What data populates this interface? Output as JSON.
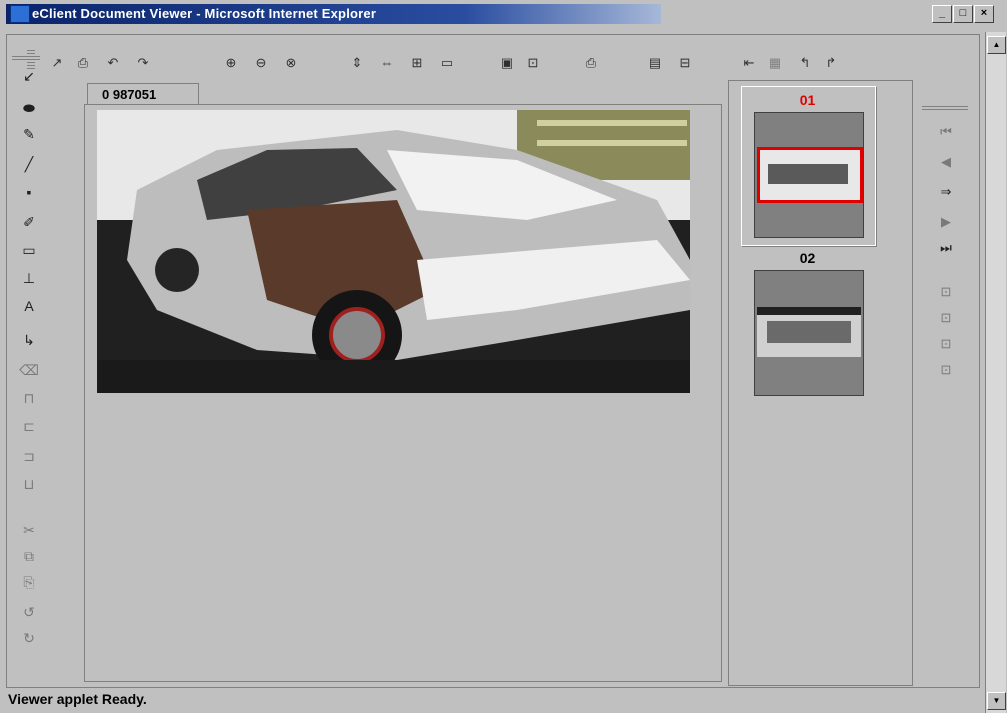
{
  "window": {
    "title": "eClient Document Viewer - Microsoft Internet Explorer"
  },
  "document_tab": {
    "label": "0 987051"
  },
  "thumbnails": [
    {
      "number": "01",
      "selected": true,
      "number_color": "#e00000"
    },
    {
      "number": "02",
      "selected": false,
      "number_color": "#000000"
    }
  ],
  "status": {
    "text": "Viewer applet Ready."
  },
  "toolbar": {
    "icons": [
      "new-annotation-icon",
      "open-icon",
      "undo-icon",
      "redo-icon",
      "zoom-in-icon",
      "zoom-out-icon",
      "zoom-fit-icon",
      "fit-height-icon",
      "fit-width-icon",
      "fit-page-icon",
      "single-page-icon",
      "image-icon",
      "unlock-icon",
      "print-icon",
      "notes-icon",
      "toolbox-icon",
      "previous-doc-icon",
      "save-icon",
      "rotate-left-icon",
      "rotate-right-icon"
    ]
  },
  "left_tools": {
    "icons": [
      "arrow-select-icon",
      "ellipse-tool-icon",
      "highlight-tool-icon",
      "line-tool-icon",
      "note-tool-icon",
      "pen-tool-icon",
      "rectangle-tool-icon",
      "stamp-tool-icon",
      "text-tool-icon",
      "pointer-move-icon",
      "eraser-icon",
      "frame-icon",
      "copy-frame-icon",
      "paste-frame-icon",
      "group-icon",
      "cut-icon",
      "copy-icon",
      "paste-icon",
      "rotate-ccw-icon",
      "rotate-cw-icon"
    ]
  },
  "right_tools": {
    "icons": [
      "first-page-icon",
      "previous-page-icon",
      "goto-page-icon",
      "next-page-icon",
      "last-page-icon",
      "first-doc-icon",
      "previous-doc-icon",
      "next-doc-icon",
      "last-doc-icon"
    ]
  }
}
